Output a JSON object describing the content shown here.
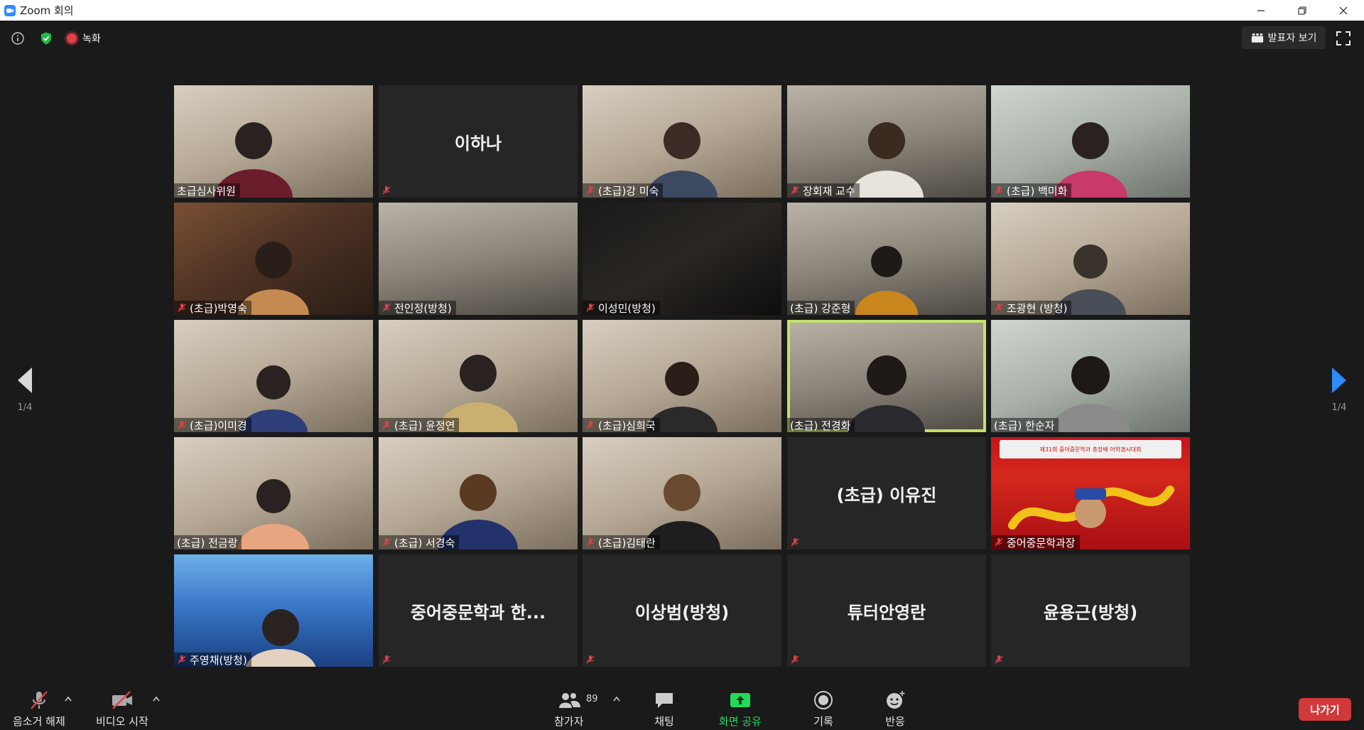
{
  "window": {
    "title": "Zoom 회의",
    "minimize_icon": "minimize-icon",
    "restore_icon": "restore-icon",
    "close_icon": "close-icon"
  },
  "topbar": {
    "info_icon": "info-icon",
    "security_icon": "shield-check-icon",
    "recording_label": "녹화",
    "speaker_view_label": "발표자 보기",
    "fullscreen_icon": "fullscreen-icon"
  },
  "pagination": {
    "left_page": "1/4",
    "right_page": "1/4"
  },
  "participants": [
    {
      "name": "초급심사위원",
      "muted": false,
      "video": true
    },
    {
      "name": "이하나",
      "muted": true,
      "video": false
    },
    {
      "name": "(초급)강 미숙",
      "muted": true,
      "video": true
    },
    {
      "name": "장회재 교수",
      "muted": true,
      "video": true
    },
    {
      "name": "(초급) 백미화",
      "muted": true,
      "video": true
    },
    {
      "name": "(초급)박영숙",
      "muted": true,
      "video": true
    },
    {
      "name": "전인정(방청)",
      "muted": true,
      "video": true
    },
    {
      "name": "이성민(방청)",
      "muted": true,
      "video": true
    },
    {
      "name": "(초급) 강준형",
      "muted": false,
      "video": true
    },
    {
      "name": "조광현 (방청)",
      "muted": true,
      "video": true
    },
    {
      "name": "(초급)이미경",
      "muted": true,
      "video": true
    },
    {
      "name": "(초급) 윤정연",
      "muted": true,
      "video": true
    },
    {
      "name": "(초급)심희국",
      "muted": true,
      "video": true
    },
    {
      "name": "(초급) 전경화",
      "muted": false,
      "video": true,
      "active_speaker": true
    },
    {
      "name": "(초급) 한순자",
      "muted": false,
      "video": true
    },
    {
      "name": "(초급) 전금랑",
      "muted": false,
      "video": true
    },
    {
      "name": "(초급) 서경숙",
      "muted": true,
      "video": true
    },
    {
      "name": "(초급)김태란",
      "muted": true,
      "video": true
    },
    {
      "name": "(초급) 이유진",
      "muted": true,
      "video": false
    },
    {
      "name": "중어중문학과장",
      "muted": true,
      "video": true
    },
    {
      "name": "주영채(방청)",
      "muted": true,
      "video": true
    },
    {
      "name": "중어중문학과 한...",
      "muted": true,
      "video": false
    },
    {
      "name": "이상범(방청)",
      "muted": true,
      "video": false
    },
    {
      "name": "튜터안영란",
      "muted": true,
      "video": false
    },
    {
      "name": "윤용근(방청)",
      "muted": true,
      "video": false
    }
  ],
  "poster": {
    "banner_text": "제31회 중어중문학과 총장배 어학경시대회"
  },
  "toolbar": {
    "unmute_label": "음소거 해제",
    "video_label": "비디오 시작",
    "participants_label": "참가자",
    "participants_count": "89",
    "chat_label": "채팅",
    "share_label": "화면 공유",
    "record_label": "기록",
    "reactions_label": "반응",
    "leave_label": "나가기"
  },
  "colors": {
    "share_green": "#23d959",
    "leave_red": "#d0393b",
    "active_border": "#c3e16b",
    "mute_red": "#e0404a",
    "nav_arrow_blue": "#2d8cff"
  }
}
